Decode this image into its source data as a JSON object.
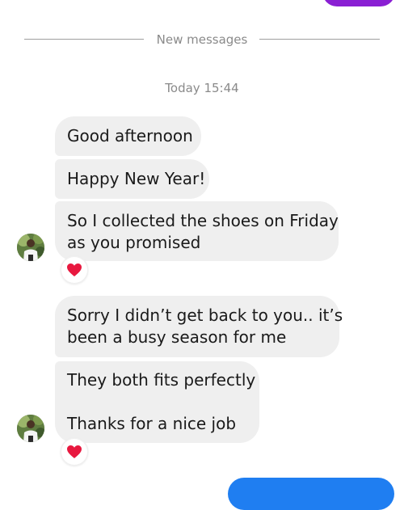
{
  "colors": {
    "outgoing_top_bubble": "#8a1fd3",
    "outgoing_bottom_bubble": "#1f7ef1",
    "incoming_bubble": "#efefef",
    "meta_text": "#8a8a8a",
    "heart": "#e8183f"
  },
  "divider": {
    "label": "New messages"
  },
  "timestamp": "Today 15:44",
  "messages": [
    {
      "text": "Good afternoon"
    },
    {
      "text": "Happy New Year!"
    },
    {
      "lines": [
        "So I collected the shoes on Friday",
        "as you promised"
      ],
      "reaction": "heart-icon"
    },
    {
      "lines": [
        "Sorry I didn’t get back to you.. it’s",
        "been a busy season for me"
      ]
    },
    {
      "lines": [
        "They both fits perfectly",
        "Thanks for a nice job"
      ],
      "reaction": "heart-icon"
    }
  ]
}
